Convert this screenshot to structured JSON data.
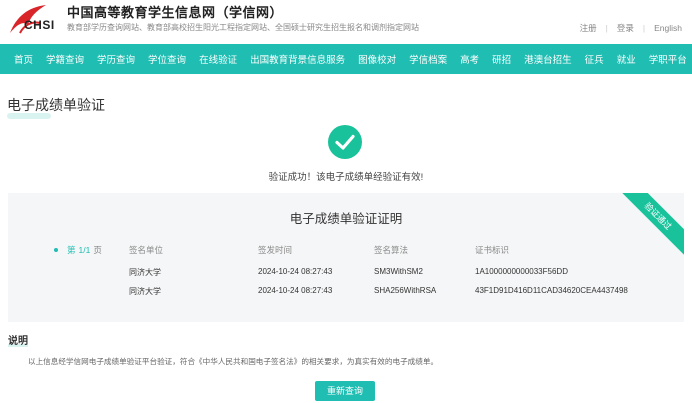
{
  "header": {
    "logo_text": "CHSI",
    "title": "中国高等教育学生信息网（学信网）",
    "subtitle": "教育部学历查询网站、教育部高校招生阳光工程指定网站、全国硕士研究生招生报名和调剂指定网站",
    "links": [
      "注册",
      "登录",
      "English"
    ]
  },
  "nav": [
    "首页",
    "学籍查询",
    "学历查询",
    "学位查询",
    "在线验证",
    "出国教育背景信息服务",
    "图像校对",
    "学信档案",
    "高考",
    "研招",
    "港澳台招生",
    "征兵",
    "就业",
    "学职平台"
  ],
  "page": {
    "title": "电子成绩单验证",
    "success_message": "验证成功！该电子成绩单经验证有效!"
  },
  "certificate": {
    "title": "电子成绩单验证证明",
    "ribbon": "验证通过",
    "pager": {
      "prefix": "第",
      "current": "1/1",
      "suffix": "页"
    },
    "columns": [
      "签名单位",
      "签发时间",
      "签名算法",
      "证书标识"
    ],
    "rows": [
      [
        "同济大学",
        "2024-10-24 08:27:43",
        "SM3WithSM2",
        "1A1000000000033F56DD"
      ],
      [
        "同济大学",
        "2024-10-24 08:27:43",
        "SHA256WithRSA",
        "43F1D91D416D11CAD34620CEA4437498"
      ]
    ]
  },
  "notes": {
    "title": "说明",
    "text": "以上信息经学信网电子成绩单验证平台验证，符合《中华人民共和国电子签名法》的相关要求，为真实有效的电子成绩单。"
  },
  "button": {
    "label": "重新查询"
  },
  "colors": {
    "accent": "#1fbdb2",
    "success": "#19c29b"
  }
}
